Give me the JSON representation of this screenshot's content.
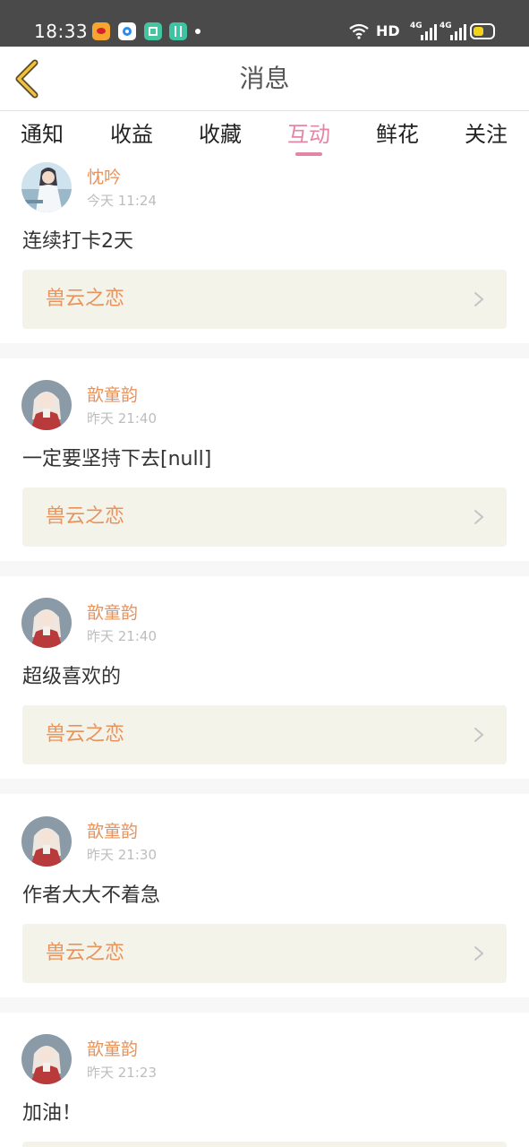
{
  "status_bar": {
    "time": "18:33",
    "icons": [
      "weibo-icon",
      "browser-icon",
      "book-app-icon",
      "cat-app-icon",
      "dot-icon",
      "wifi-icon",
      "signal-icon",
      "signal-icon",
      "battery-icon"
    ],
    "hd_label": "HD",
    "network_label_1": "4G",
    "network_label_2": "4G",
    "battery_level": 0.55,
    "battery_color": "#f5d21a"
  },
  "header": {
    "title": "消息",
    "back_icon": "chevron-left-icon"
  },
  "tabs": {
    "items": [
      {
        "label": "通知"
      },
      {
        "label": "收益"
      },
      {
        "label": "收藏"
      },
      {
        "label": "互动"
      },
      {
        "label": "鲜花"
      },
      {
        "label": "关注"
      }
    ],
    "active_label": "互动",
    "active_color": "#e585a6"
  },
  "colors": {
    "accent": "#e585a6",
    "username": "#e8935c",
    "book_link_bg": "#f4f3ea"
  },
  "messages": [
    {
      "user_name": "忱吟",
      "time": "今天 11:24",
      "content": "连续打卡2天",
      "book_title": "兽云之恋"
    },
    {
      "user_name": "歆童韵",
      "time": "昨天 21:40",
      "content": "一定要坚持下去[null]",
      "book_title": "兽云之恋"
    },
    {
      "user_name": "歆童韵",
      "time": "昨天 21:40",
      "content": "超级喜欢的",
      "book_title": "兽云之恋"
    },
    {
      "user_name": "歆童韵",
      "time": "昨天 21:30",
      "content": "作者大大不着急",
      "book_title": "兽云之恋"
    },
    {
      "user_name": "歆童韵",
      "time": "昨天 21:23",
      "content": "加油！",
      "book_title": ""
    }
  ]
}
